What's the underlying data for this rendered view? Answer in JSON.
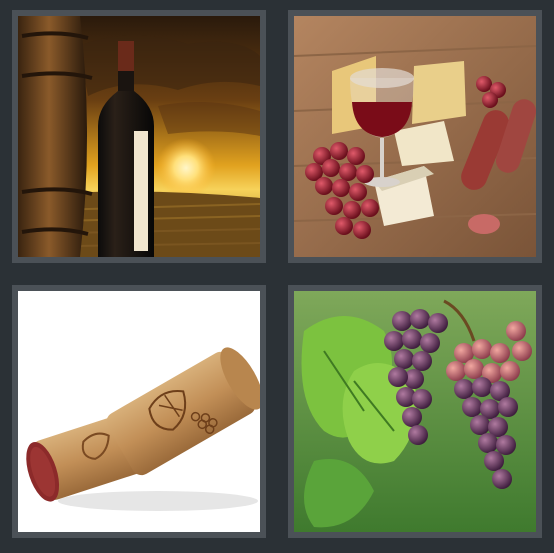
{
  "puzzle": {
    "answer_hidden": true,
    "tiles": [
      {
        "subject": "wine-bottle-barrel-sunset"
      },
      {
        "subject": "red-wine-cheese-salami-grapes"
      },
      {
        "subject": "wine-corks"
      },
      {
        "subject": "grape-vine-bunches"
      }
    ]
  },
  "colors": {
    "background": "#2b3136",
    "frame": "#4b5157"
  }
}
